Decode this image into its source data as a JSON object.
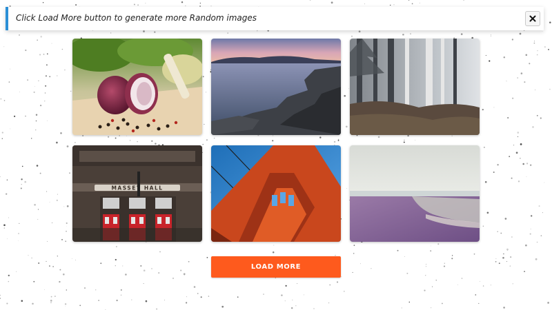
{
  "notice": {
    "text": "Click Load More button to generate more Random images",
    "accent_color": "#2b8fd6",
    "close_icon": "close-icon"
  },
  "gallery": {
    "images": [
      {
        "subject": "onion-and-peppercorns-photo"
      },
      {
        "subject": "rocky-coast-at-sunset-photo"
      },
      {
        "subject": "misty-forest-photo"
      },
      {
        "subject": "massey-hall-building-photo",
        "sign_text": "MASSEY HALL"
      },
      {
        "subject": "golden-gate-bridge-tower-photo"
      },
      {
        "subject": "hazy-beach-photo"
      }
    ]
  },
  "load_more": {
    "label": "LOAD MORE",
    "color": "#fe5a1d"
  }
}
